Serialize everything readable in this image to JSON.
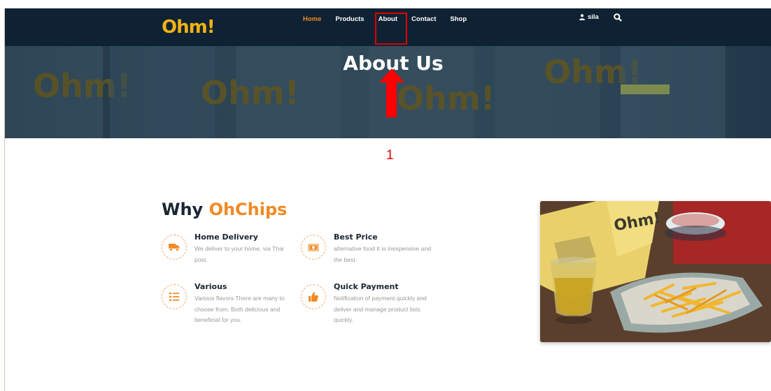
{
  "header": {
    "logo_text": "Ohm!",
    "nav": [
      {
        "label": "Home",
        "active": true
      },
      {
        "label": "Products",
        "active": false
      },
      {
        "label": "About",
        "active": false
      },
      {
        "label": "Contact",
        "active": false
      },
      {
        "label": "Shop",
        "active": false
      }
    ],
    "user_label": "sila",
    "icons": {
      "user": "user-icon",
      "search": "search-icon"
    }
  },
  "hero": {
    "title": "About Us"
  },
  "annotation": {
    "step_number": "1",
    "color": "#e00000"
  },
  "why": {
    "title_prefix": "Why",
    "title_accent": "OhChips",
    "features": [
      {
        "title": "Home Delivery",
        "description": "We deliver to your home. via Thai post.",
        "icon": "truck-icon"
      },
      {
        "title": "Best Price",
        "description": "alternative food It is inexpensive and the best.",
        "icon": "money-icon"
      },
      {
        "title": "Various",
        "description": "Various flavors There are many to choose from. Both delicious and beneficial for you.",
        "icon": "list-icon"
      },
      {
        "title": "Quick Payment",
        "description": "Notification of payment quickly and deliver and manage product lists quickly.",
        "icon": "thumbs-up-icon"
      }
    ]
  },
  "colors": {
    "navbar": "#0f2233",
    "accent": "#f08a24",
    "heading": "#1a2633"
  }
}
